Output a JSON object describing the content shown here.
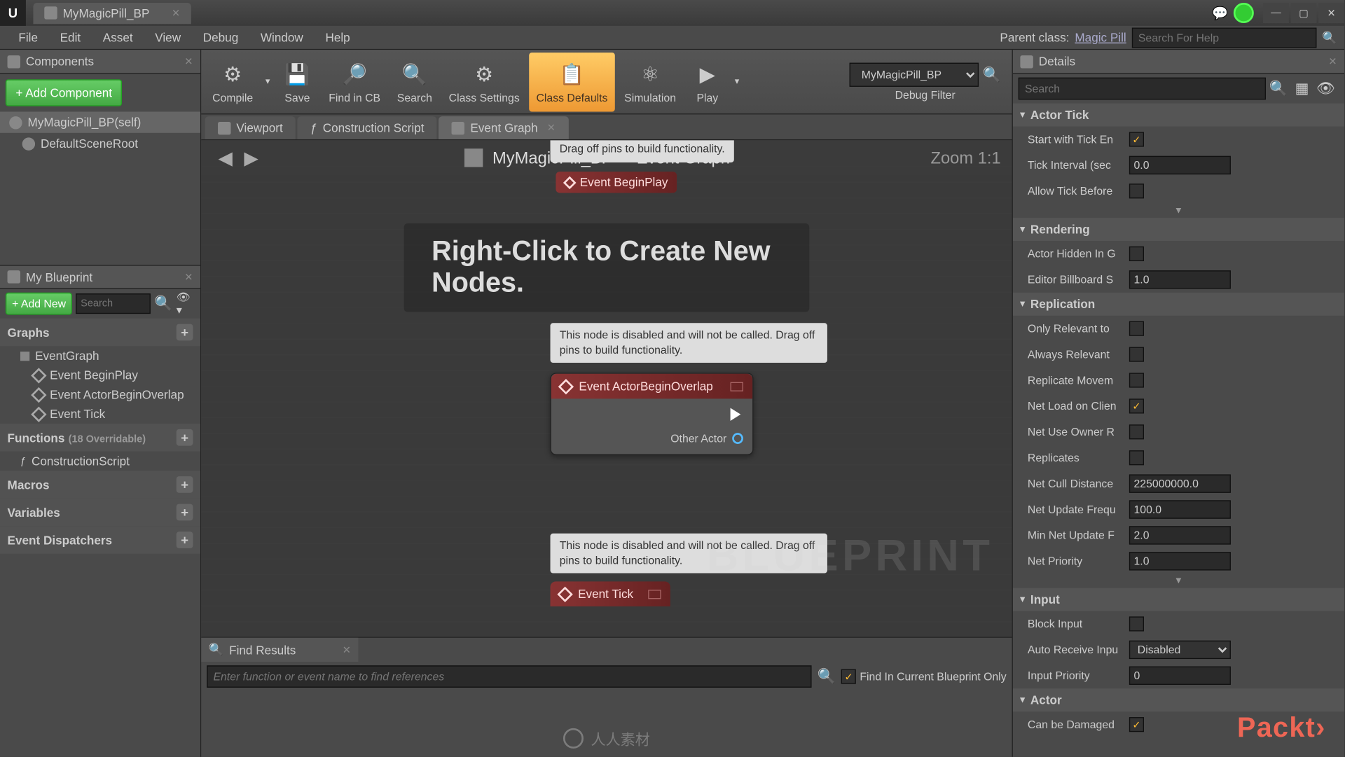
{
  "title_tab": "MyMagicPill_BP",
  "menu": [
    "File",
    "Edit",
    "Asset",
    "View",
    "Debug",
    "Window",
    "Help"
  ],
  "parent_class_label": "Parent class:",
  "parent_class": "Magic Pill",
  "help_search_placeholder": "Search For Help",
  "components": {
    "title": "Components",
    "add": "+ Add Component",
    "items": [
      "MyMagicPill_BP(self)",
      "DefaultSceneRoot"
    ]
  },
  "my_blueprint": {
    "title": "My Blueprint",
    "add": "+ Add New",
    "search_placeholder": "Search",
    "graphs": {
      "label": "Graphs",
      "root": "EventGraph",
      "items": [
        "Event BeginPlay",
        "Event ActorBeginOverlap",
        "Event Tick"
      ]
    },
    "functions": {
      "label": "Functions",
      "overridable": "(18 Overridable)",
      "items": [
        "ConstructionScript"
      ]
    },
    "macros": "Macros",
    "variables": "Variables",
    "dispatchers": "Event Dispatchers"
  },
  "toolbar": {
    "compile": "Compile",
    "save": "Save",
    "find": "Find in CB",
    "search": "Search",
    "class_settings": "Class Settings",
    "class_defaults": "Class Defaults",
    "simulation": "Simulation",
    "play": "Play",
    "debug_sel": "MyMagicPill_BP",
    "debug_label": "Debug Filter"
  },
  "editor_tabs": {
    "viewport": "Viewport",
    "construction": "Construction Script",
    "event": "Event Graph"
  },
  "graph": {
    "bc1": "MyMagicPill_BP",
    "bc2": "Event Graph",
    "zoom": "Zoom 1:1",
    "hint": "Right-Click to Create New Nodes.",
    "tip": "This node is disabled and will not be called. Drag off pins to build functionality.",
    "tip_partial": "Drag off pins to build functionality.",
    "n1": "Event BeginPlay",
    "n2": "Event ActorBeginOverlap",
    "pin": "Other Actor",
    "n3": "Event Tick",
    "wm": "BLUEPRINT"
  },
  "find": {
    "title": "Find Results",
    "placeholder": "Enter function or event name to find references",
    "chk": "Find In Current Blueprint Only"
  },
  "details": {
    "title": "Details",
    "search_placeholder": "Search",
    "actor_tick": {
      "h": "Actor Tick",
      "r1": "Start with Tick En",
      "r2": "Tick Interval (sec",
      "v2": "0.0",
      "r3": "Allow Tick Before"
    },
    "rendering": {
      "h": "Rendering",
      "r1": "Actor Hidden In G",
      "r2": "Editor Billboard S",
      "v2": "1.0"
    },
    "replication": {
      "h": "Replication",
      "r1": "Only Relevant to",
      "r2": "Always Relevant",
      "r3": "Replicate Movem",
      "r4": "Net Load on Clien",
      "r5": "Net Use Owner R",
      "r6": "Replicates",
      "r7": "Net Cull Distance",
      "v7": "225000000.0",
      "r8": "Net Update Frequ",
      "v8": "100.0",
      "r9": "Min Net Update F",
      "v9": "2.0",
      "r10": "Net Priority",
      "v10": "1.0"
    },
    "input": {
      "h": "Input",
      "r1": "Block Input",
      "r2": "Auto Receive Inpu",
      "v2": "Disabled",
      "r3": "Input Priority",
      "v3": "0"
    },
    "actor": {
      "h": "Actor",
      "r1": "Can be Damaged"
    }
  },
  "packt": "Packt",
  "cn": "人人素材"
}
